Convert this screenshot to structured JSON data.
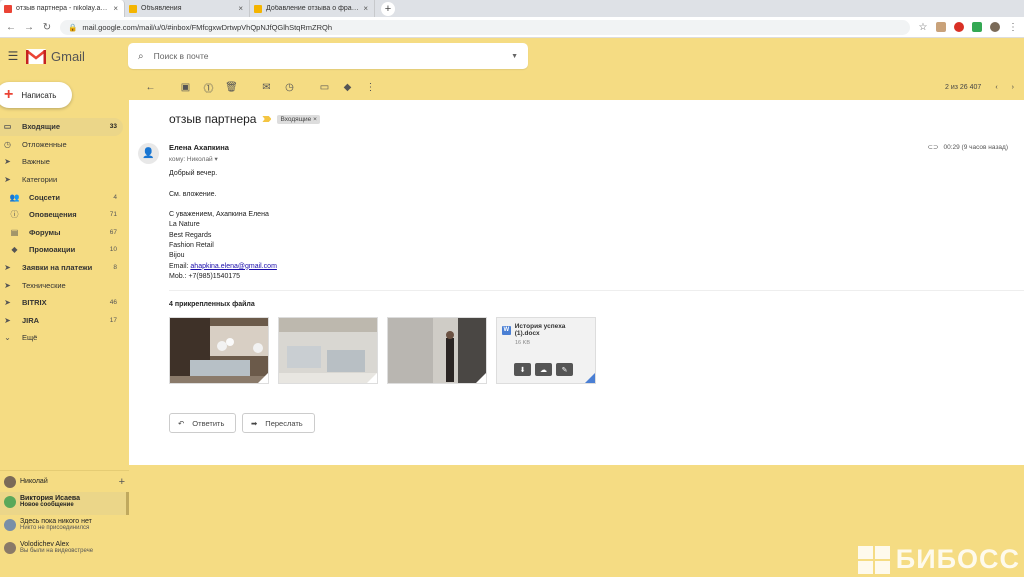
{
  "browser": {
    "tabs": [
      {
        "title": "отзыв партнера - nikolay.aseeva",
        "active": true,
        "favicon_color": "#ea4335"
      },
      {
        "title": "Объявления",
        "active": false,
        "favicon_color": "#f4b400"
      },
      {
        "title": "Добавление отзыва о франшизе",
        "active": false,
        "favicon_color": "#f4b400"
      }
    ],
    "url": "mail.google.com/mail/u/0/#inbox/FMfcgxwDrtwpVhQpNJfQGlhStqRmZRQh"
  },
  "gmail": {
    "logo_text": "Gmail",
    "search_placeholder": "Поиск в почте"
  },
  "sidebar": {
    "compose_label": "Написать",
    "labels": [
      {
        "name": "Входящие",
        "count": "33",
        "icon": "inbox-icon",
        "active": true,
        "bold": true,
        "sub": false
      },
      {
        "name": "Отложенные",
        "count": "",
        "icon": "clock-icon",
        "active": false,
        "bold": false,
        "sub": false
      },
      {
        "name": "Важные",
        "count": "",
        "icon": "important-icon",
        "active": false,
        "bold": false,
        "sub": false
      },
      {
        "name": "Категории",
        "count": "",
        "icon": "label-icon",
        "active": false,
        "bold": false,
        "sub": false
      },
      {
        "name": "Соцсети",
        "count": "4",
        "icon": "people-icon",
        "active": false,
        "bold": true,
        "sub": true
      },
      {
        "name": "Оповещения",
        "count": "71",
        "icon": "info-icon",
        "active": false,
        "bold": true,
        "sub": true
      },
      {
        "name": "Форумы",
        "count": "67",
        "icon": "forum-icon",
        "active": false,
        "bold": true,
        "sub": true
      },
      {
        "name": "Промоакции",
        "count": "10",
        "icon": "tag-icon",
        "active": false,
        "bold": true,
        "sub": true
      },
      {
        "name": "Заявки на платежи",
        "count": "8",
        "icon": "label-icon",
        "active": false,
        "bold": true,
        "sub": false
      },
      {
        "name": "Технические",
        "count": "",
        "icon": "label-icon",
        "active": false,
        "bold": false,
        "sub": false
      },
      {
        "name": "BITRIX",
        "count": "46",
        "icon": "label-icon",
        "active": false,
        "bold": true,
        "sub": false
      },
      {
        "name": "JIRA",
        "count": "17",
        "icon": "label-icon",
        "active": false,
        "bold": true,
        "sub": false
      },
      {
        "name": "Ещё",
        "count": "",
        "icon": "chevron-down-icon",
        "active": false,
        "bold": false,
        "sub": false
      }
    ]
  },
  "chat": {
    "user_name": "Николай",
    "contacts": [
      {
        "name": "Виктория Исаева",
        "status": "Новое сообщение",
        "bold": true,
        "highlight": true,
        "color": "#5aa85a"
      },
      {
        "name": "Здесь пока никого нет",
        "status": "Никто не присоединился",
        "bold": false,
        "highlight": false,
        "color": "#7a8fa6"
      },
      {
        "name": "Volodichev Alex",
        "status": "Вы были на видеовстрече",
        "bold": false,
        "highlight": false,
        "color": "#8a7a68"
      }
    ]
  },
  "toolbar": {
    "pager": "2 из 26 407"
  },
  "message": {
    "subject": "отзыв партнера",
    "label_chip": "Входящие",
    "sender_name": "Елена Ахапкина",
    "to_line": "кому: Николай",
    "time": "00:29 (9 часов назад)",
    "body_lines": [
      "Добрый вечер.",
      "",
      "См. вложение.",
      "",
      "С уважением, Ахапкина Елена",
      "La Nature",
      "Best Regards",
      "Fashion Retail",
      "Bijou"
    ],
    "email_label": "Email:",
    "email": "ahapkina.elena@gmail.com",
    "mob": "Mob.: +7(985)1540175",
    "attachments_title": "4 прикрепленных файла",
    "doc_name": "История успеха (1).docx",
    "doc_size": "16 KB",
    "reply_label": "Ответить",
    "forward_label": "Переслать"
  },
  "watermark": "БИБОСС"
}
